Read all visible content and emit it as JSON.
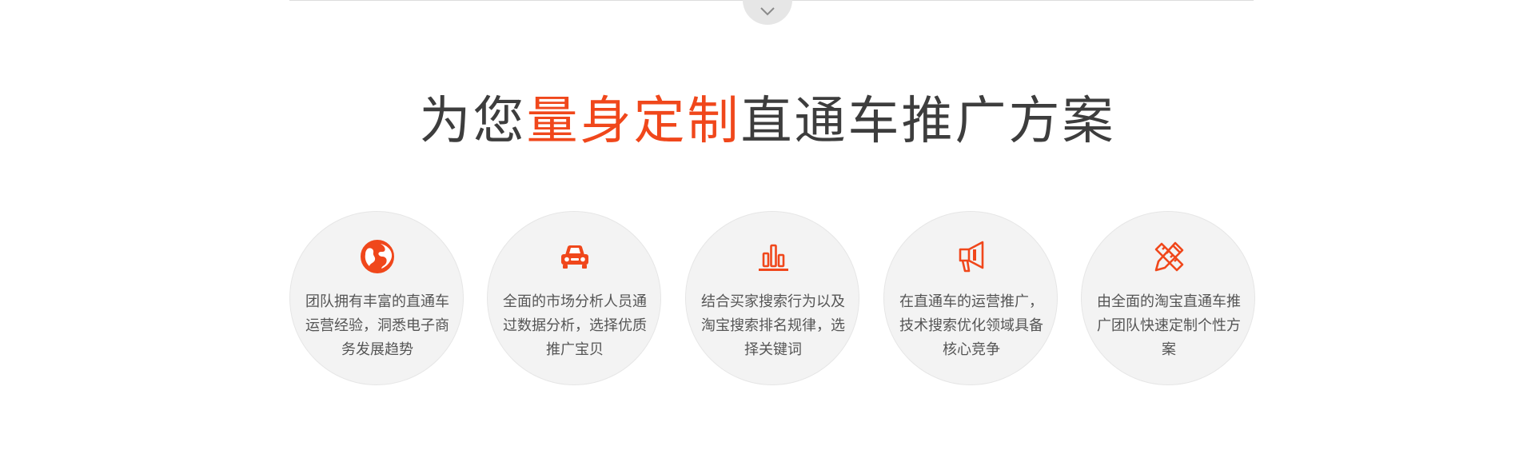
{
  "theme": {
    "accent": "#f0471b",
    "text": "#3d3d3d",
    "desc_text": "#555555",
    "circle_bg": "#f3f3f3"
  },
  "header": {
    "title_prefix": "为您",
    "title_highlight": "量身定制",
    "title_suffix": "直通车推广方案",
    "scroll_icon": "chevron-down-icon"
  },
  "features": [
    {
      "icon": "globe-icon",
      "text": "团队拥有丰富的直通车运营经验，洞悉电子商务发展趋势"
    },
    {
      "icon": "car-icon",
      "text": "全面的市场分析人员通过数据分析，选择优质推广宝贝"
    },
    {
      "icon": "bar-chart-icon",
      "text": "结合买家搜索行为以及淘宝搜索排名规律，选择关键词"
    },
    {
      "icon": "megaphone-icon",
      "text": "在直通车的运营推广，技术搜索优化领域具备核心竞争"
    },
    {
      "icon": "pencil-ruler-icon",
      "text": "由全面的淘宝直通车推广团队快速定制个性方案"
    }
  ]
}
